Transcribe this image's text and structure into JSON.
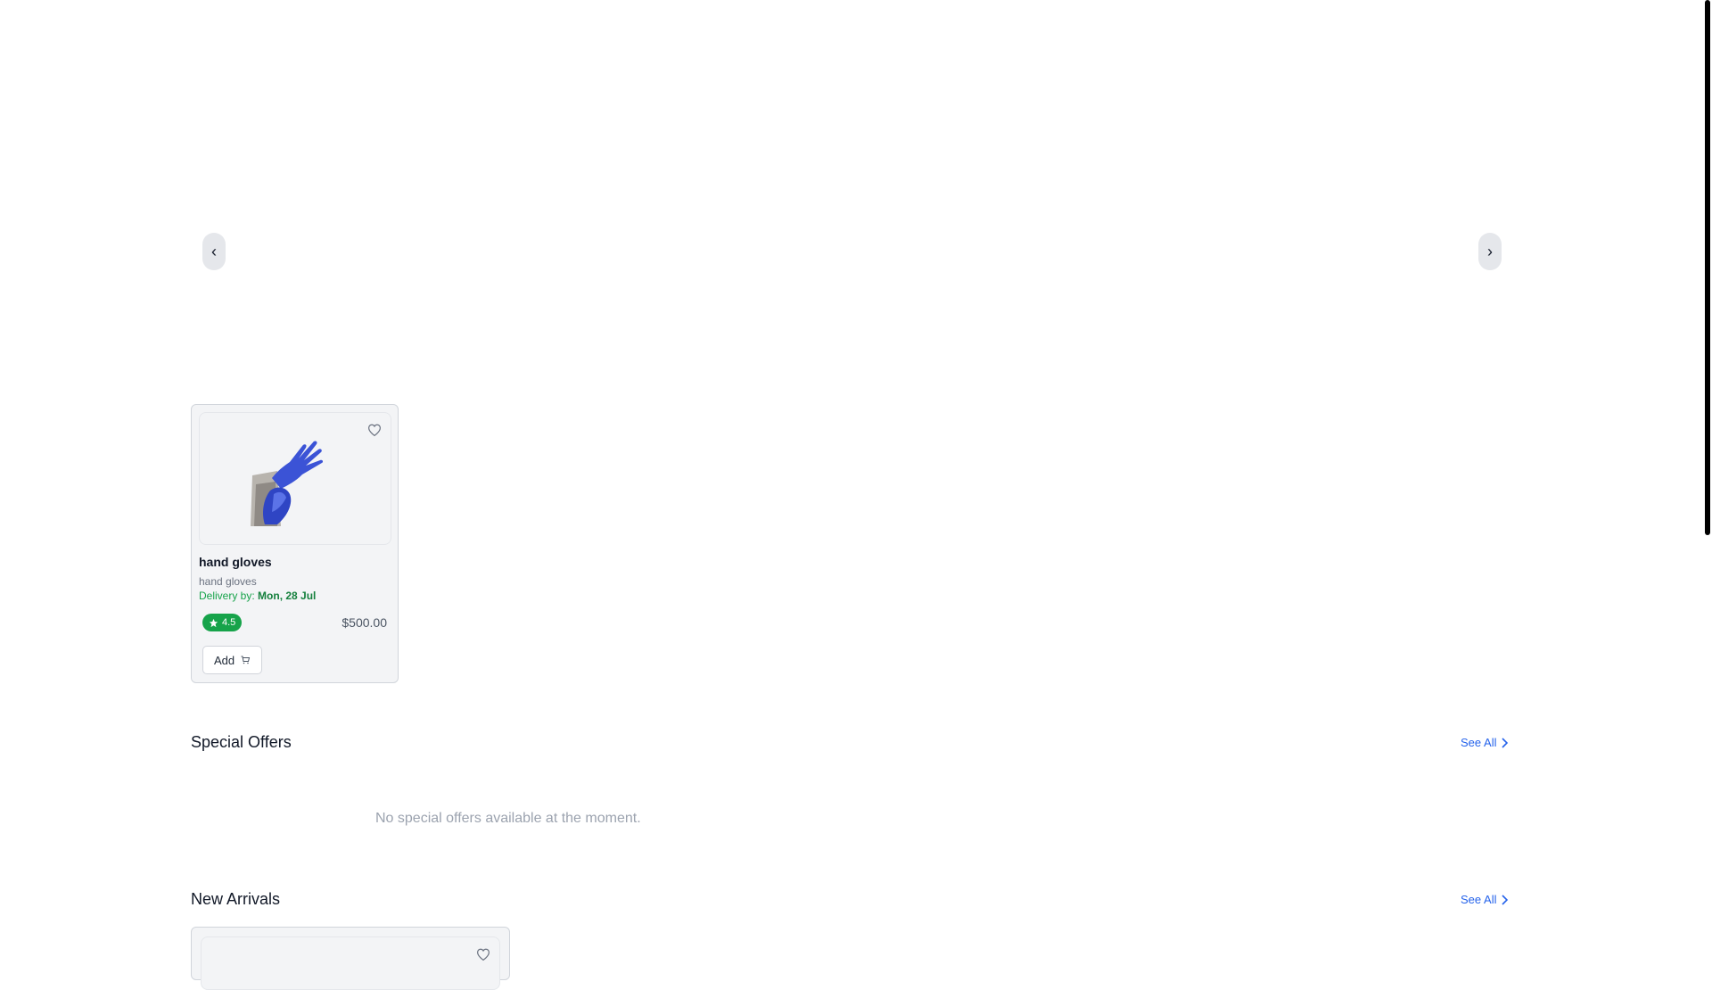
{
  "carousel": {
    "prev_label": "‹",
    "next_label": "›"
  },
  "product": {
    "name": "hand gloves",
    "description": "hand gloves",
    "delivery_prefix": "Delivery by:",
    "delivery_date": "Mon, 28 Jul",
    "rating": "4.5",
    "price": "$500.00",
    "add_label": "Add",
    "image_icon": "blue-glove-image",
    "favorite_icon": "heart-icon",
    "rating_color": "#16a34a"
  },
  "special_offers": {
    "title": "Special Offers",
    "see_all": "See All",
    "empty_message": "No special offers available at the moment."
  },
  "new_arrivals": {
    "title": "New Arrivals",
    "see_all": "See All"
  },
  "colors": {
    "accent": "#2563eb",
    "success": "#16a34a"
  }
}
